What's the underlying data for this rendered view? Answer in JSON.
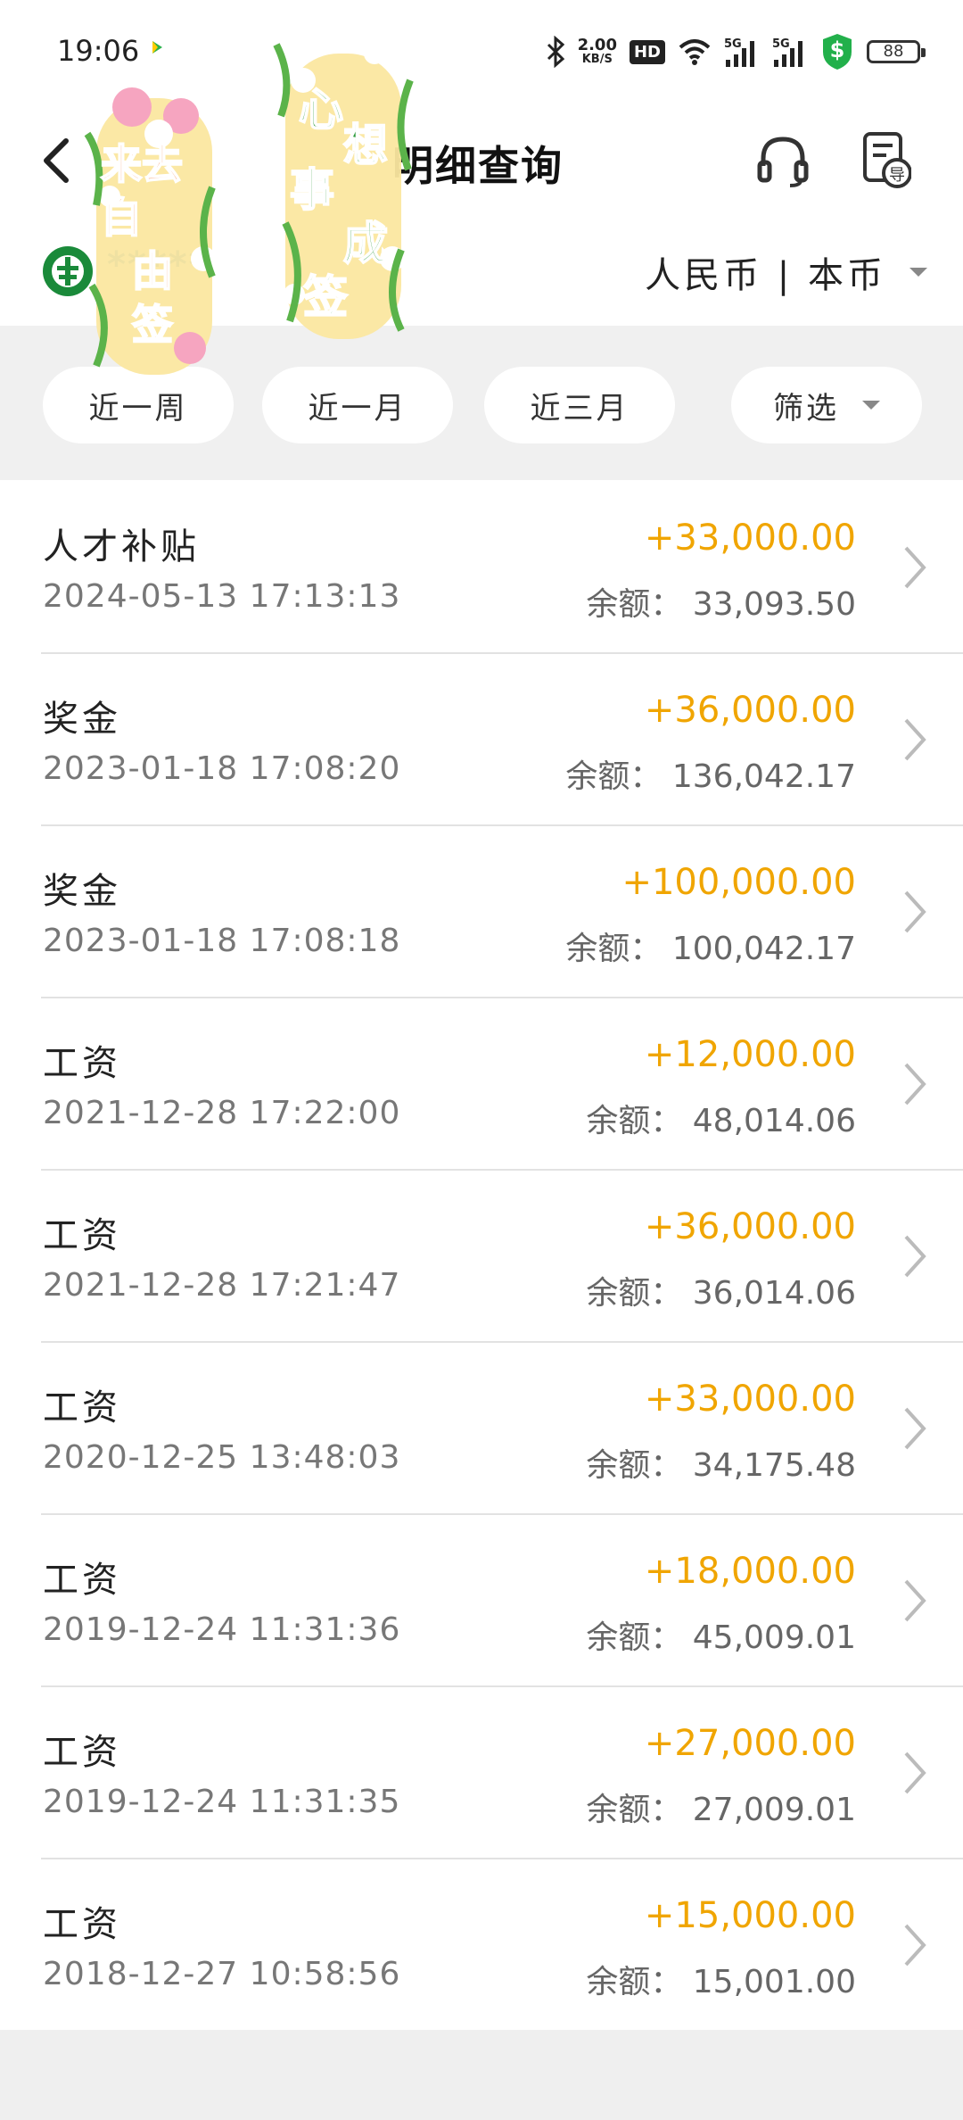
{
  "status_bar": {
    "time": "19:06",
    "net_speed_value": "2.00",
    "net_speed_unit": "KB/S",
    "hd_label": "HD",
    "battery": "88",
    "signal_label_1": "5G",
    "signal_label_2": "5G",
    "shield_symbol": "$"
  },
  "header": {
    "title": "明细查询"
  },
  "account": {
    "number_masked": "*****",
    "currency": "人民币 | 本币"
  },
  "filters": [
    {
      "label": "近一周"
    },
    {
      "label": "近一月"
    },
    {
      "label": "近三月"
    },
    {
      "label": "筛选"
    }
  ],
  "stickers": {
    "left_text": "来去自由签",
    "right_text": "心想事成签"
  },
  "balance_prefix": "余额：",
  "transactions": [
    {
      "title": "人才补贴",
      "date": "2024-05-13 17:13:13",
      "amount": "+33,000.00",
      "balance": "余额：  33,093.50"
    },
    {
      "title": "奖金",
      "date": "2023-01-18 17:08:20",
      "amount": "+36,000.00",
      "balance": "余额：  136,042.17"
    },
    {
      "title": "奖金",
      "date": "2023-01-18 17:08:18",
      "amount": "+100,000.00",
      "balance": "余额：  100,042.17"
    },
    {
      "title": "工资",
      "date": "2021-12-28 17:22:00",
      "amount": "+12,000.00",
      "balance": "余额：  48,014.06"
    },
    {
      "title": "工资",
      "date": "2021-12-28 17:21:47",
      "amount": "+36,000.00",
      "balance": "余额：  36,014.06"
    },
    {
      "title": "工资",
      "date": "2020-12-25 13:48:03",
      "amount": "+33,000.00",
      "balance": "余额：  34,175.48"
    },
    {
      "title": "工资",
      "date": "2019-12-24 11:31:36",
      "amount": "+18,000.00",
      "balance": "余额：  45,009.01"
    },
    {
      "title": "工资",
      "date": "2019-12-24 11:31:35",
      "amount": "+27,000.00",
      "balance": "余额：  27,009.01"
    },
    {
      "title": "工资",
      "date": "2018-12-27 10:58:56",
      "amount": "+15,000.00",
      "balance": "余额：  15,001.00"
    }
  ],
  "colors": {
    "amount": "#f0a500",
    "bank_green": "#1a8a3a",
    "sticker_green": "#2e9b3c",
    "sticker_orange": "#f06d1f"
  },
  "icons": {
    "back": "chevron-left-icon",
    "support": "headset-icon",
    "export": "export-document-icon",
    "row_chevron": "chevron-right-icon",
    "bank_logo": "bank-logo-icon"
  }
}
